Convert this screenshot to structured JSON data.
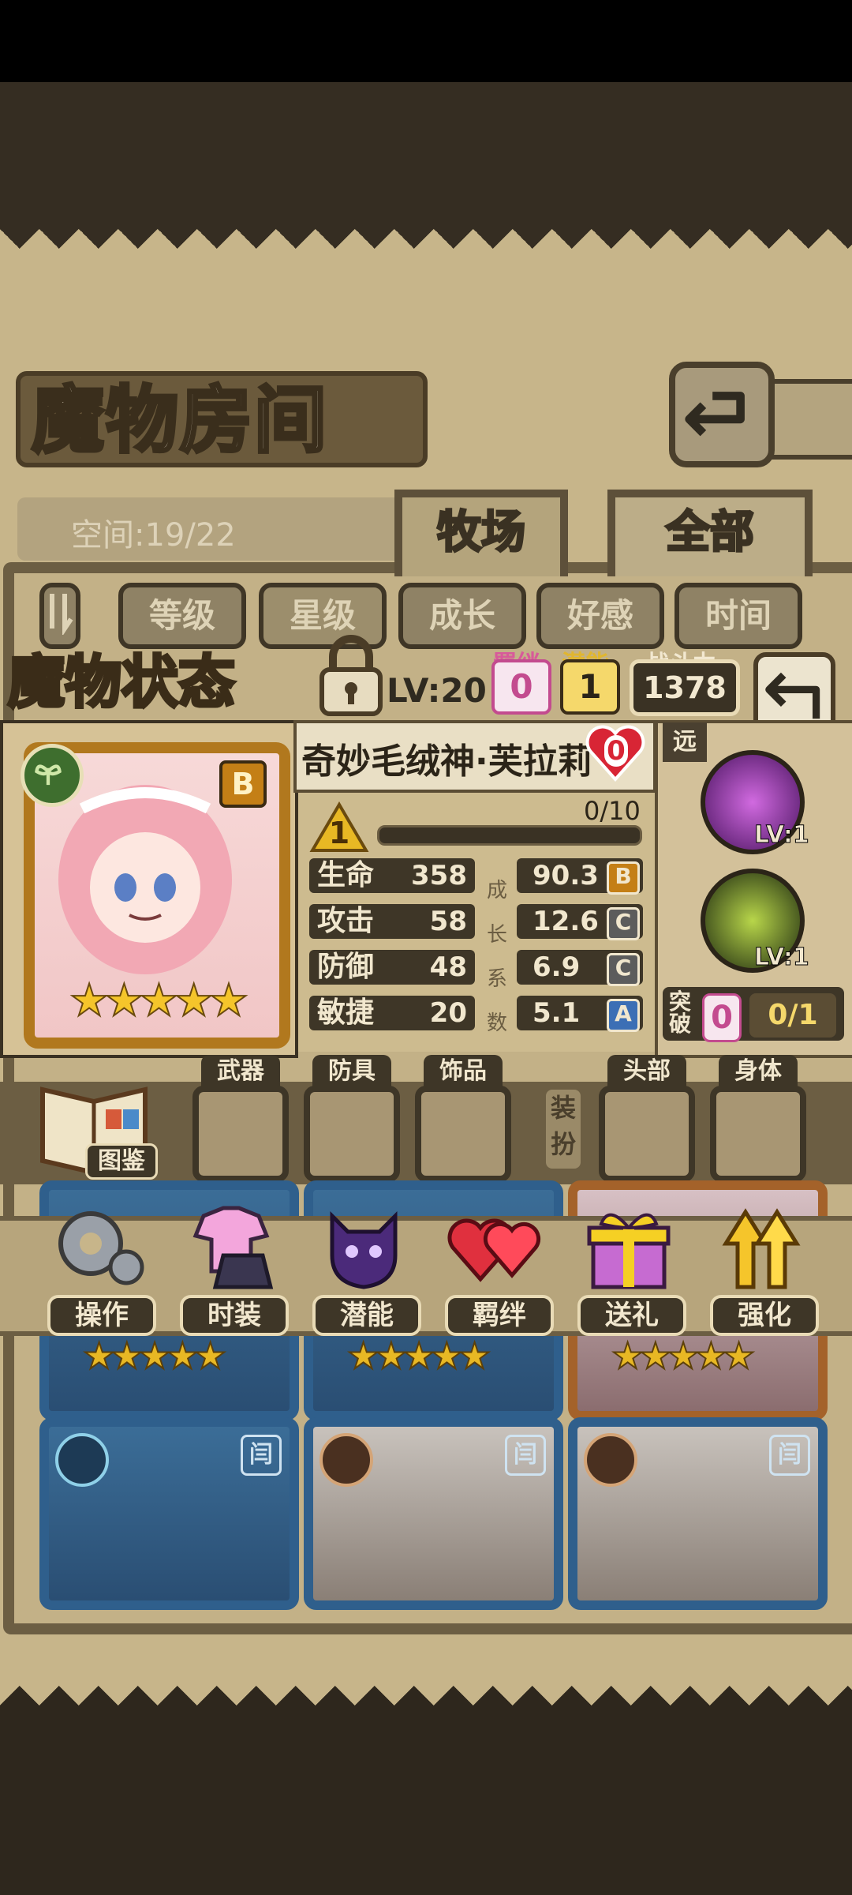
{
  "header": {
    "title": "魔物房间",
    "capacity": "空间:19/22",
    "tabs": [
      {
        "label": "牧场"
      },
      {
        "label": "全部"
      }
    ]
  },
  "filters": [
    "等级",
    "星级",
    "成长",
    "好感",
    "时间"
  ],
  "status": {
    "section_title": "魔物状态",
    "level": "LV:20",
    "bond_label": "羁绊",
    "bond_value": "0",
    "potential_label": "潜能",
    "potential_value": "1",
    "power_label": "战斗力",
    "power_value": "1378",
    "monster_name": "奇妙毛绒神·芙拉莉",
    "heart_value": "0",
    "rank": "B",
    "stars": "★★★★★",
    "star_level": "1",
    "xp": "0/10",
    "growth_label": [
      "成",
      "长",
      "系",
      "数"
    ],
    "stats": [
      {
        "name": "生命",
        "value": "358",
        "growth": "90.3",
        "grade": "B"
      },
      {
        "name": "攻击",
        "value": "58",
        "growth": "12.6",
        "grade": "C"
      },
      {
        "name": "防御",
        "value": "48",
        "growth": "6.9",
        "grade": "C"
      },
      {
        "name": "敏捷",
        "value": "20",
        "growth": "5.1",
        "grade": "A"
      }
    ],
    "range": "远",
    "skills": [
      {
        "level": "LV:1"
      },
      {
        "level": "LV:1"
      }
    ],
    "break_label": "突破",
    "break_value": "0",
    "break_count": "0/1"
  },
  "equipment": {
    "book_label": "图鉴",
    "slots": [
      "武器",
      "防具",
      "饰品",
      "头部",
      "身体"
    ],
    "dress_label": "装扮"
  },
  "actions": [
    "操作",
    "时装",
    "潜能",
    "羁绊",
    "送礼",
    "强化"
  ],
  "card_badge": "闫",
  "colors": {
    "accent": "#6c5e43",
    "parchment": "#c7b58a",
    "gold": "#f5c52b",
    "pink": "#c34b8f"
  }
}
